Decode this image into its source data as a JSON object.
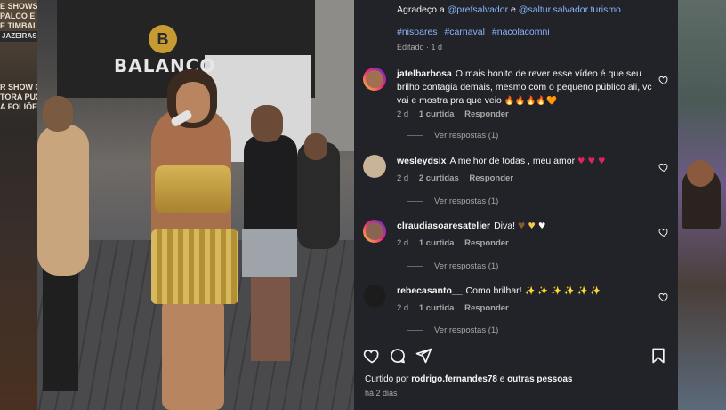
{
  "background_left": {
    "top_lines": [
      "E SHOWS",
      "PALCO E",
      "E TIMBAL"
    ],
    "band1": "JAZEIRAS",
    "mid_lines": [
      "R SHOW CA",
      "TORA PUXA",
      "A FOLIÕES"
    ]
  },
  "video": {
    "logo_text": "BALANÇO",
    "logo_mark": "B"
  },
  "post": {
    "caption_prefix": "Agradeço a",
    "mention1": "@prefsalvador",
    "conjunction": "e",
    "mention2": "@saltur.salvador.turismo",
    "hashtags": [
      "#nisoares",
      "#carnaval",
      "#nacolacomni"
    ],
    "edited": "Editado · 1 d"
  },
  "comments": [
    {
      "username": "jatelbarbosa",
      "text": "O mais bonito de rever esse vídeo é que seu brilho contagia demais, mesmo com o pequeno público ali, vc vai e mostra pra que veio",
      "emoji": [
        "🔥",
        "🔥",
        "🔥",
        "🔥",
        "🧡"
      ],
      "time": "2 d",
      "likes": "1 curtida",
      "reply": "Responder",
      "view_replies": "Ver respostas (1)"
    },
    {
      "username": "wesleydsix",
      "text": "A melhor de todas , meu amor",
      "emoji": [
        "♥",
        "♥",
        "♥"
      ],
      "time": "2 d",
      "likes": "2 curtidas",
      "reply": "Responder",
      "view_replies": "Ver respostas (1)"
    },
    {
      "username": "clraudiasoaresatelier",
      "text": "Diva!",
      "emoji": [
        "♥",
        "♥",
        "♥"
      ],
      "time": "2 d",
      "likes": "1 curtida",
      "reply": "Responder",
      "view_replies": "Ver respostas (1)"
    },
    {
      "username": "rebecasanto__",
      "text": "Como brilhar!",
      "emoji": [
        "✨",
        "✨",
        "✨",
        "✨",
        "✨",
        "✨"
      ],
      "time": "2 d",
      "likes": "1 curtida",
      "reply": "Responder",
      "view_replies": "Ver respostas (1)"
    }
  ],
  "footer": {
    "liked_prefix": "Curtido por",
    "liked_user": "rodrigo.fernandes78",
    "liked_mid": "e",
    "liked_others": "outras pessoas",
    "time_ago": "há 2 dias"
  },
  "icons": [
    "heart-icon",
    "comment-icon",
    "share-icon",
    "bookmark-icon"
  ],
  "colors": {
    "panel_bg": "#212328",
    "link": "#8ab4f8",
    "muted": "#a8a8a8"
  }
}
